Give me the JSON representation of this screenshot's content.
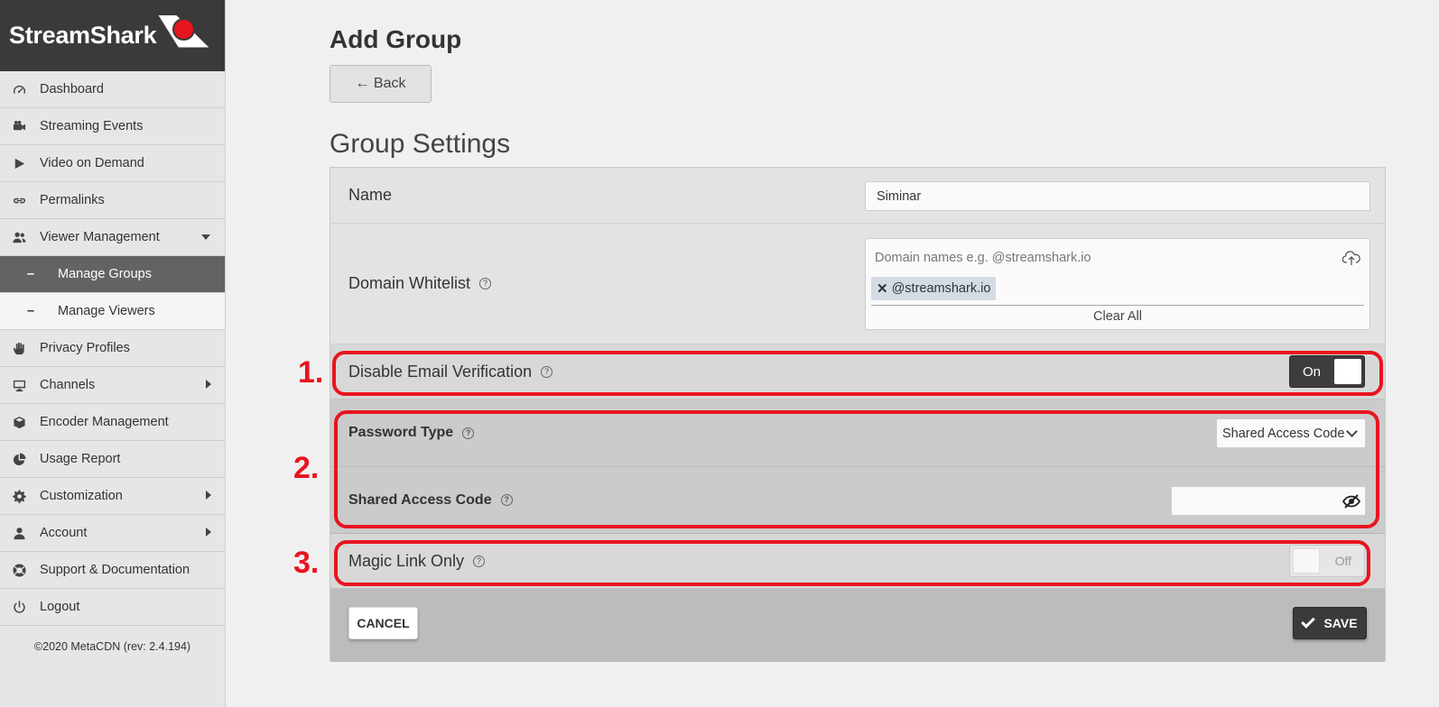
{
  "app": {
    "brand": "StreamShark"
  },
  "sidebar": {
    "items": [
      {
        "label": "Dashboard",
        "icon": "gauge-icon"
      },
      {
        "label": "Streaming Events",
        "icon": "video-camera-icon"
      },
      {
        "label": "Video on Demand",
        "icon": "play-icon"
      },
      {
        "label": "Permalinks",
        "icon": "link-icon"
      },
      {
        "label": "Viewer Management",
        "icon": "users-icon",
        "expanded": true
      },
      {
        "label": "Privacy Profiles",
        "icon": "hand-icon"
      },
      {
        "label": "Channels",
        "icon": "monitor-icon"
      },
      {
        "label": "Encoder Management",
        "icon": "cube-icon"
      },
      {
        "label": "Usage Report",
        "icon": "pie-chart-icon"
      },
      {
        "label": "Customization",
        "icon": "gear-icon"
      },
      {
        "label": "Account",
        "icon": "user-icon"
      },
      {
        "label": "Support & Documentation",
        "icon": "life-ring-icon"
      },
      {
        "label": "Logout",
        "icon": "power-icon"
      }
    ],
    "subitems": [
      {
        "label": "Manage Groups",
        "active": true
      },
      {
        "label": "Manage Viewers",
        "active": false
      }
    ],
    "copyright": "©2020 MetaCDN (rev: 2.4.194)"
  },
  "page": {
    "title": "Add Group",
    "back_label": "← Back",
    "section_title": "Group Settings"
  },
  "form": {
    "name_label": "Name",
    "name_value": "Siminar",
    "domain_label": "Domain Whitelist",
    "domain_placeholder": "Domain names e.g. @streamshark.io",
    "domain_tag": "@streamshark.io",
    "domain_tag_remove": "✕",
    "clear_all": "Clear All",
    "email_label": "Disable Email Verification",
    "email_toggle": "On",
    "password_type_label": "Password Type",
    "password_type_value": "Shared Access Code",
    "shared_access_label": "Shared Access Code",
    "shared_access_value": "",
    "magic_label": "Magic Link Only",
    "magic_toggle": "Off",
    "help": "?",
    "cancel_label": "CANCEL",
    "save_label": "SAVE"
  },
  "annotations": [
    "1.",
    "2.",
    "3."
  ],
  "colors": {
    "annotation": "#e8141e",
    "sidebar_header": "#3a3a3a",
    "active_nav": "#636363",
    "toggle_on": "#3d3d3d"
  }
}
